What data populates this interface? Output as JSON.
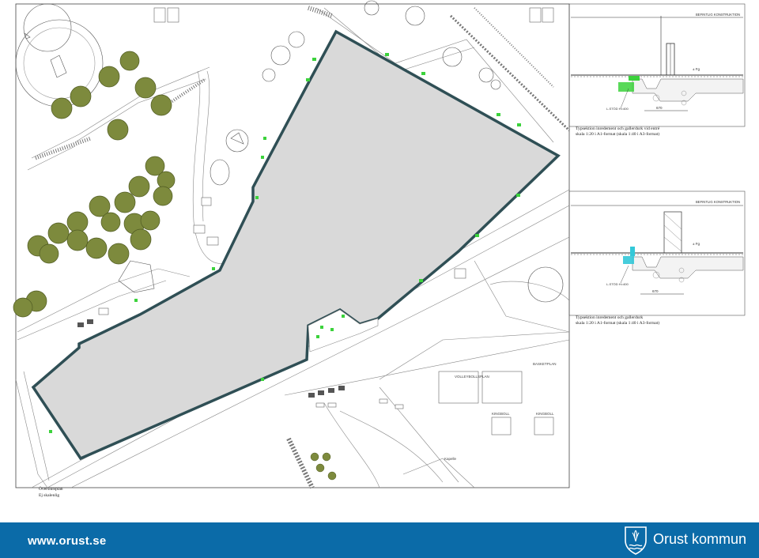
{
  "plan": {
    "caption_line1": "Översiktsplan",
    "caption_line2": "Ej skalenlig"
  },
  "plan_labels": {
    "field1": "VOLLEYBOLLSPLAN",
    "field2": "BASKETPLAN",
    "field3": "KINGBOLL",
    "field4": "KINGBOLL",
    "road": "Kapelle"
  },
  "detail_top": {
    "header": "BEFINTLIG KONSTRUKTION",
    "level": "± Fg",
    "post_label": "L-STÖD H=400",
    "dimension": "670",
    "caption_line1": "Typsektion inredement och gallerdurk vid entré",
    "caption_line2": "skala 1:20 i A1-format (skala 1:40 i A3-format)"
  },
  "detail_bottom": {
    "header": "BEFINTLIG KONSTRUKTION",
    "level": "± Fg",
    "post_label": "L-STÖD H=400",
    "dimension": "670",
    "caption_line1": "Typsektion inredement och gallerdurk",
    "caption_line2": "skala 1:20 i A1-format (skala 1:40 i A3-format)"
  },
  "footer": {
    "url": "www.orust.se",
    "brand": "Orust kommun"
  },
  "colors": {
    "footer_blue": "#0b6ba8",
    "building_fill": "#d9d9d9",
    "building_outline": "#2f4f55",
    "tree_fill": "#7d8a3d",
    "accent_green": "#3cd23c",
    "accent_cyan": "#33c8d8"
  }
}
